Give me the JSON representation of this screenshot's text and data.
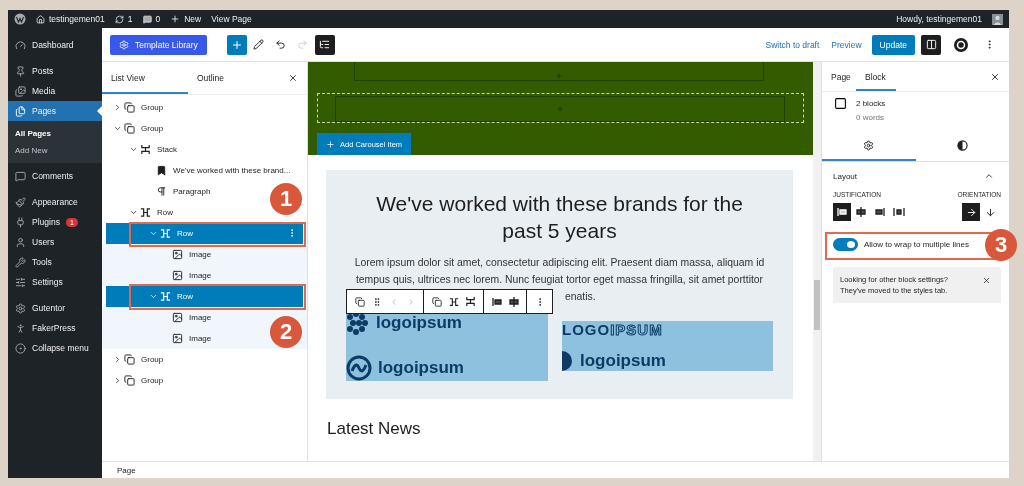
{
  "admin_bar": {
    "site": "testingemen01",
    "updates": "1",
    "comments": "0",
    "new": "New",
    "view": "View Page",
    "greeting": "Howdy, testingemen01"
  },
  "menu_groups": [
    {
      "items": [
        {
          "label": "Dashboard",
          "kind": "dashboard",
          "selected": false
        }
      ]
    },
    {
      "items": [
        {
          "label": "Posts",
          "kind": "pin",
          "selected": false
        },
        {
          "label": "Media",
          "kind": "media",
          "selected": false
        },
        {
          "label": "Pages",
          "kind": "pages",
          "selected": true,
          "submenu": [
            {
              "label": "All Pages",
              "selected": true
            },
            {
              "label": "Add New",
              "selected": false
            }
          ]
        },
        {
          "label": "Comments",
          "kind": "comment",
          "selected": false
        }
      ]
    },
    {
      "items": [
        {
          "label": "Appearance",
          "kind": "brush",
          "selected": false
        },
        {
          "label": "Plugins",
          "kind": "plug",
          "selected": false,
          "badge": "1"
        },
        {
          "label": "Users",
          "kind": "user",
          "selected": false
        },
        {
          "label": "Tools",
          "kind": "wrench",
          "selected": false
        },
        {
          "label": "Settings",
          "kind": "sliders",
          "selected": false
        }
      ]
    },
    {
      "items": [
        {
          "label": "Gutentor",
          "kind": "gear",
          "selected": false
        },
        {
          "label": "FakerPress",
          "kind": "person",
          "selected": false
        },
        {
          "label": "Collapse menu",
          "kind": "collapse",
          "selected": false
        }
      ]
    }
  ],
  "toolbar": {
    "template_button": "Template Library",
    "list_view_open": true,
    "links": [
      "Switch to draft",
      "Preview"
    ],
    "primary": "Update",
    "sidebar_open": true
  },
  "list_panel": {
    "tabs": [
      {
        "label": "List View",
        "selected": true
      },
      {
        "label": "Outline",
        "selected": false
      }
    ]
  },
  "tree": [
    {
      "label": "Group",
      "kind": "group",
      "expanded": false,
      "selected": false
    },
    {
      "label": "Group",
      "kind": "group",
      "expanded": true,
      "selected": false,
      "children": [
        {
          "label": "Stack",
          "kind": "stack",
          "expanded": true,
          "selected": false,
          "children": [
            {
              "label": "We've worked with these brand...",
              "kind": "heading",
              "selected": false
            },
            {
              "label": "Paragraph",
              "kind": "paragraph",
              "selected": false
            }
          ]
        },
        {
          "label": "Row",
          "kind": "row",
          "expanded": true,
          "selected": false,
          "children": [
            {
              "label": "Row",
              "kind": "row",
              "expanded": true,
              "selected": true,
              "options_shown": true,
              "children": [
                {
                  "label": "Image",
                  "kind": "image",
                  "selected": false
                },
                {
                  "label": "Image",
                  "kind": "image",
                  "selected": false
                }
              ]
            },
            {
              "label": "Row",
              "kind": "row",
              "expanded": true,
              "selected": true,
              "options_shown": false,
              "children": [
                {
                  "label": "Image",
                  "kind": "image",
                  "selected": false
                },
                {
                  "label": "Image",
                  "kind": "image",
                  "selected": false
                }
              ]
            }
          ]
        }
      ]
    },
    {
      "label": "Group",
      "kind": "group",
      "expanded": false,
      "selected": false
    },
    {
      "label": "Group",
      "kind": "group",
      "expanded": false,
      "selected": false
    }
  ],
  "canvas": {
    "carousel_button": "Add Carousel Item",
    "heading": "We've worked with these brands for the past 5 years",
    "paragraph_lines": [
      "Lorem ipsum dolor sit amet, consectetur adipiscing elit. Praesent diam massa, aliquam id",
      "tempus quis, ultrices nec lorem. Nunc feugiat tortor eget massa fringilla, sit amet porttitor",
      "enatis."
    ],
    "logo_images": [
      {
        "logos": [
          {
            "text": "logoipsum",
            "kind": "dots"
          },
          {
            "text": "logoipsum",
            "kind": "circle"
          }
        ]
      },
      {
        "logos": [
          {
            "text": "LOGO",
            "outline_text": "IPSUM",
            "kind": "plain"
          },
          {
            "text": "logoipsum",
            "kind": "half"
          }
        ]
      }
    ],
    "news_heading": "Latest News"
  },
  "settings_panel": {
    "tabs": [
      {
        "label": "Page",
        "selected": false
      },
      {
        "label": "Block",
        "selected": true
      }
    ],
    "summary": {
      "count": "2 blocks",
      "words": "0 words"
    },
    "icon_tabs": [
      {
        "kind": "settings",
        "selected": true
      },
      {
        "kind": "styles",
        "selected": false
      }
    ],
    "layout": {
      "title": "Layout",
      "expanded": true,
      "justification_label": "JUSTIFICATION",
      "justification": [
        {
          "kind": "left",
          "selected": true
        },
        {
          "kind": "center",
          "selected": false
        },
        {
          "kind": "right",
          "selected": false
        },
        {
          "kind": "between",
          "selected": false
        }
      ],
      "orientation_label": "ORIENTATION",
      "orientation": [
        {
          "kind": "horizontal",
          "selected": true
        },
        {
          "kind": "vertical",
          "selected": false
        }
      ],
      "wrap": {
        "label": "Allow to wrap to multiple lines",
        "on": true
      }
    },
    "notice": "Looking for other block settings? They've moved to the styles tab."
  },
  "footer": {
    "breadcrumb": "Page"
  },
  "annotations": [
    {
      "label": "1"
    },
    {
      "label": "2"
    },
    {
      "label": "3"
    }
  ]
}
